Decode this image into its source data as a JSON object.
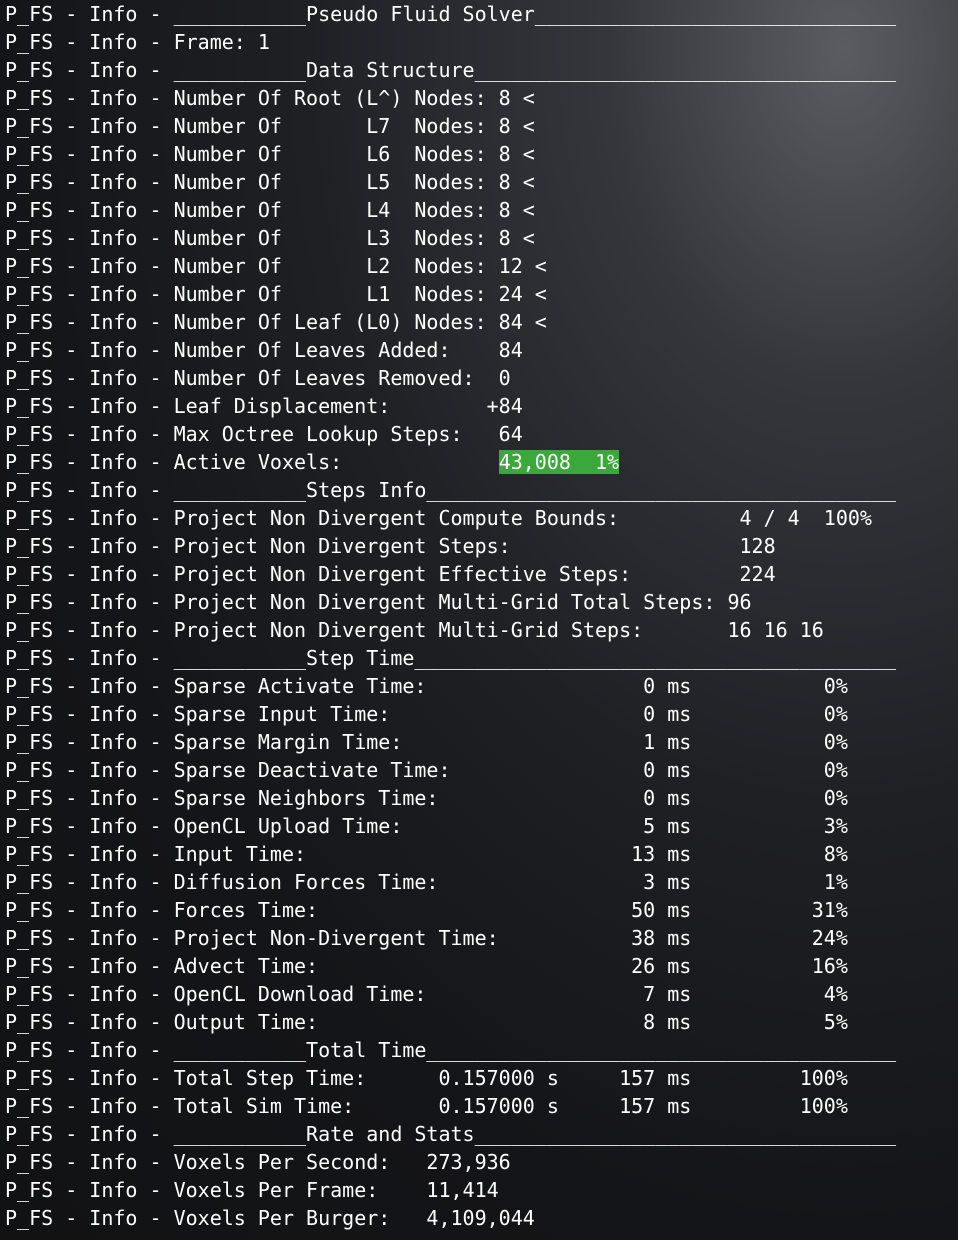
{
  "lines": [
    {
      "text": "P_FS - Info - ___________Pseudo Fluid Solver______________________________"
    },
    {
      "text": "P_FS - Info - Frame: 1"
    },
    {
      "text": "P_FS - Info - ___________Data Structure___________________________________"
    },
    {
      "text": "P_FS - Info - Number Of Root (L^) Nodes: 8 <"
    },
    {
      "text": "P_FS - Info - Number Of       L7  Nodes: 8 <"
    },
    {
      "text": "P_FS - Info - Number Of       L6  Nodes: 8 <"
    },
    {
      "text": "P_FS - Info - Number Of       L5  Nodes: 8 <"
    },
    {
      "text": "P_FS - Info - Number Of       L4  Nodes: 8 <"
    },
    {
      "text": "P_FS - Info - Number Of       L3  Nodes: 8 <"
    },
    {
      "text": "P_FS - Info - Number Of       L2  Nodes: 12 <"
    },
    {
      "text": "P_FS - Info - Number Of       L1  Nodes: 24 <"
    },
    {
      "text": "P_FS - Info - Number Of Leaf (L0) Nodes: 84 <"
    },
    {
      "text": "P_FS - Info - Number Of Leaves Added:    84"
    },
    {
      "text": "P_FS - Info - Number Of Leaves Removed:  0"
    },
    {
      "text": "P_FS - Info - Leaf Displacement:        +84"
    },
    {
      "text": "P_FS - Info - Max Octree Lookup Steps:   64"
    },
    {
      "text": "P_FS - Info - Active Voxels:             ",
      "highlight": "43,008  1%"
    },
    {
      "text": "P_FS - Info - ___________Steps Info_______________________________________"
    },
    {
      "text": "P_FS - Info - Project Non Divergent Compute Bounds:          4 / 4  100%"
    },
    {
      "text": "P_FS - Info - Project Non Divergent Steps:                   128"
    },
    {
      "text": "P_FS - Info - Project Non Divergent Effective Steps:         224"
    },
    {
      "text": "P_FS - Info - Project Non Divergent Multi-Grid Total Steps: 96"
    },
    {
      "text": "P_FS - Info - Project Non Divergent Multi-Grid Steps:       16 16 16"
    },
    {
      "text": "P_FS - Info - ___________Step Time________________________________________"
    },
    {
      "text": "P_FS - Info - Sparse Activate Time:                  0 ms           0%"
    },
    {
      "text": "P_FS - Info - Sparse Input Time:                     0 ms           0%"
    },
    {
      "text": "P_FS - Info - Sparse Margin Time:                    1 ms           0%"
    },
    {
      "text": "P_FS - Info - Sparse Deactivate Time:                0 ms           0%"
    },
    {
      "text": "P_FS - Info - Sparse Neighbors Time:                 0 ms           0%"
    },
    {
      "text": "P_FS - Info - OpenCL Upload Time:                    5 ms           3%"
    },
    {
      "text": "P_FS - Info - Input Time:                           13 ms           8%"
    },
    {
      "text": "P_FS - Info - Diffusion Forces Time:                 3 ms           1%"
    },
    {
      "text": "P_FS - Info - Forces Time:                          50 ms          31%"
    },
    {
      "text": "P_FS - Info - Project Non-Divergent Time:           38 ms          24%"
    },
    {
      "text": "P_FS - Info - Advect Time:                          26 ms          16%"
    },
    {
      "text": "P_FS - Info - OpenCL Download Time:                  7 ms           4%"
    },
    {
      "text": "P_FS - Info - Output Time:                           8 ms           5%"
    },
    {
      "text": "P_FS - Info - ___________Total Time_______________________________________"
    },
    {
      "text": "P_FS - Info - Total Step Time:      0.157000 s     157 ms         100%"
    },
    {
      "text": "P_FS - Info - Total Sim Time:       0.157000 s     157 ms         100%"
    },
    {
      "text": "P_FS - Info - ___________Rate and Stats___________________________________"
    },
    {
      "text": "P_FS - Info - Voxels Per Second:   273,936"
    },
    {
      "text": "P_FS - Info - Voxels Per Frame:    11,414"
    },
    {
      "text": "P_FS - Info - Voxels Per Burger:   4,109,044"
    }
  ]
}
